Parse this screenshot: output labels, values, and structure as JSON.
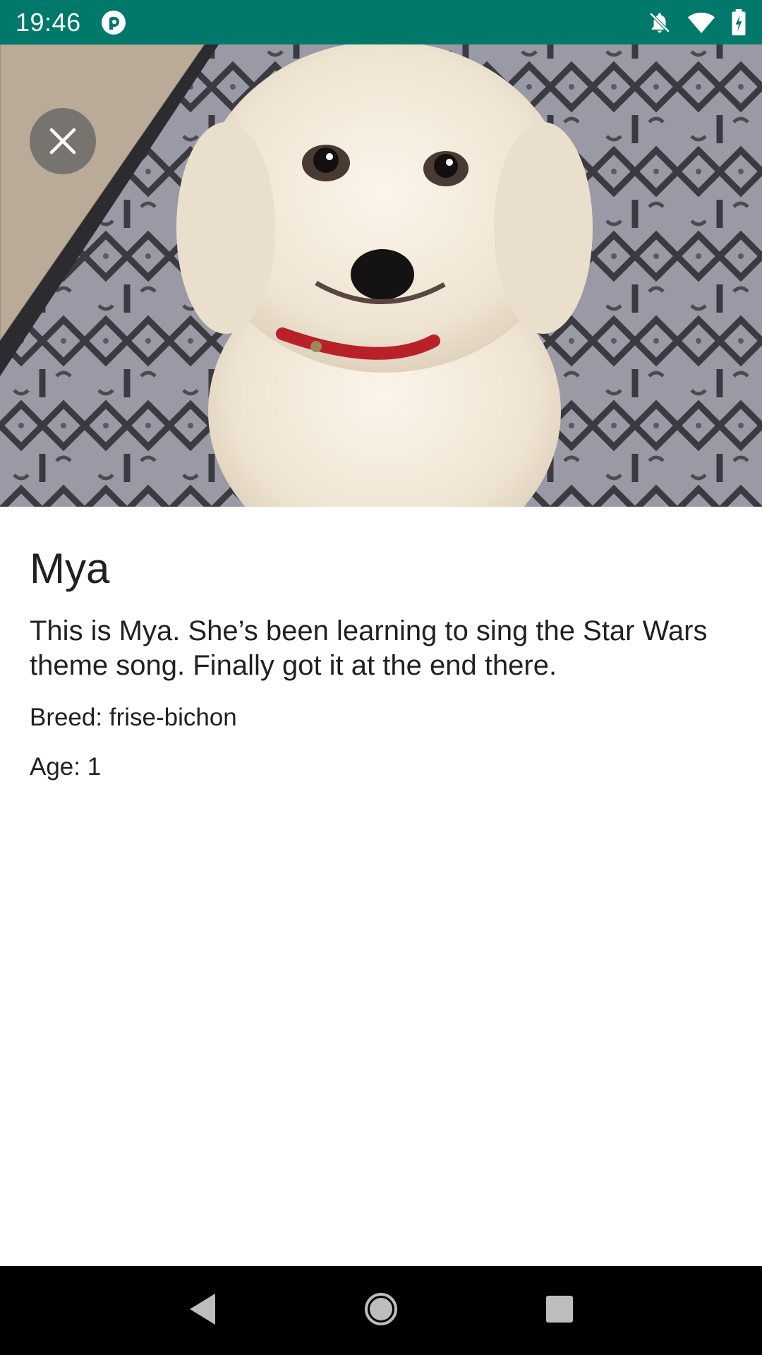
{
  "status_bar": {
    "time": "19:46",
    "app_icon": "pocket-casts-icon",
    "icons": [
      "notifications-off-icon",
      "wifi-icon",
      "battery-charging-icon"
    ],
    "background_color": "#00796b"
  },
  "hero": {
    "image": "dog-photo",
    "close_icon": "close-icon"
  },
  "dog": {
    "name": "Mya",
    "description": "This is Mya. She’s been learning to sing the Star Wars theme song. Finally got it at the end there.",
    "breed": "Breed: frise-bichon",
    "age": "Age: 1"
  },
  "nav_bar": {
    "buttons": [
      "back-icon",
      "home-icon",
      "recents-icon"
    ]
  }
}
